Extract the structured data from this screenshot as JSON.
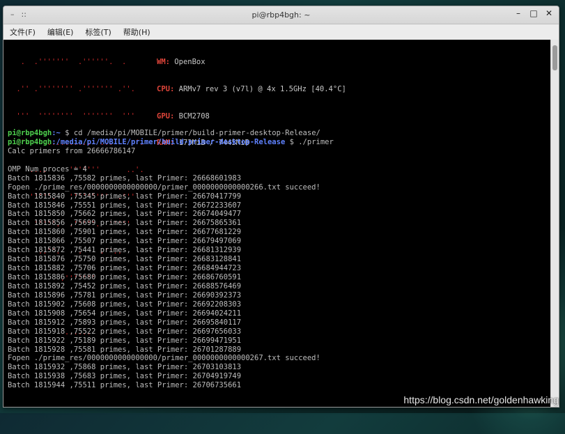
{
  "window": {
    "title": "pi@rbp4bgh: ~",
    "left_glyphs": [
      "–",
      "::"
    ],
    "controls": {
      "minimize": "–",
      "maximize": "□",
      "close": "✕"
    }
  },
  "menu": [
    "文件(F)",
    "编辑(E)",
    "标签(T)",
    "帮助(H)"
  ],
  "ascii_logo": [
    "  .  .'''''''  .''''''.  .",
    " .'' .'''''''' .''''''' .''.",
    " '''  ''''''''  '''''''  '''",
    " .'     ..........  ...     '.",
    "    ....     '''''''      ..'.",
    "    '''''.   '''''''''  .''''",
    "     '''''.  .'''''.  '''''",
    "      ..''.    .    .''..",
    "           .'''''''",
    "",
    "            ......"
  ],
  "sysinfo": [
    {
      "key": "WM:",
      "value": "OpenBox"
    },
    {
      "key": "CPU:",
      "value": "ARMv7 rev 3 (v7l) @ 4x 1.5GHz [40.4°C]"
    },
    {
      "key": "GPU:",
      "value": "BCM2708"
    },
    {
      "key": "RAM:",
      "value": "173MiB / 7445MiB"
    }
  ],
  "prompt1": {
    "user": "pi@rbp4bgh",
    "path": ":~",
    "cmd": " $ cd /media/pi/MOBILE/primer/build-primer-desktop-Release/"
  },
  "prompt2": {
    "user": "pi@rbp4bgh",
    "path": ":/media/pi/MOBILE/primer/build-primer-desktop-Release",
    "cmd": " $ ./primer"
  },
  "output": [
    "Calc primers from 26666786147",
    "",
    "OMP Num proces = 4",
    "Batch 1815836 ,75582 primes, last Primer: 26668601983",
    "Fopen ./prime_res/0000000000000000/primer_0000000000000266.txt succeed!",
    "Batch 1815840 ,75345 primes, last Primer: 26670417799",
    "Batch 1815846 ,75551 primes, last Primer: 26672233607",
    "Batch 1815850 ,75662 primes, last Primer: 26674049477",
    "Batch 1815856 ,75699 primes, last Primer: 26675865361",
    "Batch 1815860 ,75901 primes, last Primer: 26677681229",
    "Batch 1815866 ,75507 primes, last Primer: 26679497069",
    "Batch 1815872 ,75441 primes, last Primer: 26681312939",
    "Batch 1815876 ,75750 primes, last Primer: 26683128841",
    "Batch 1815882 ,75706 primes, last Primer: 26684944723",
    "Batch 1815886 ,75680 primes, last Primer: 26686760591",
    "Batch 1815892 ,75452 primes, last Primer: 26688576469",
    "Batch 1815896 ,75781 primes, last Primer: 26690392373",
    "Batch 1815902 ,75608 primes, last Primer: 26692208303",
    "Batch 1815908 ,75654 primes, last Primer: 26694024211",
    "Batch 1815912 ,75893 primes, last Primer: 26695840117",
    "Batch 1815918 ,75522 primes, last Primer: 26697656033",
    "Batch 1815922 ,75189 primes, last Primer: 26699471951",
    "Batch 1815928 ,75581 primes, last Primer: 26701287889",
    "Fopen ./prime_res/0000000000000000/primer_0000000000000267.txt succeed!",
    "Batch 1815932 ,75868 primes, last Primer: 26703103813",
    "Batch 1815938 ,75683 primes, last Primer: 26704919749",
    "Batch 1815944 ,75511 primes, last Primer: 26706735661"
  ],
  "watermark": "https://blog.csdn.net/goldenhawking"
}
